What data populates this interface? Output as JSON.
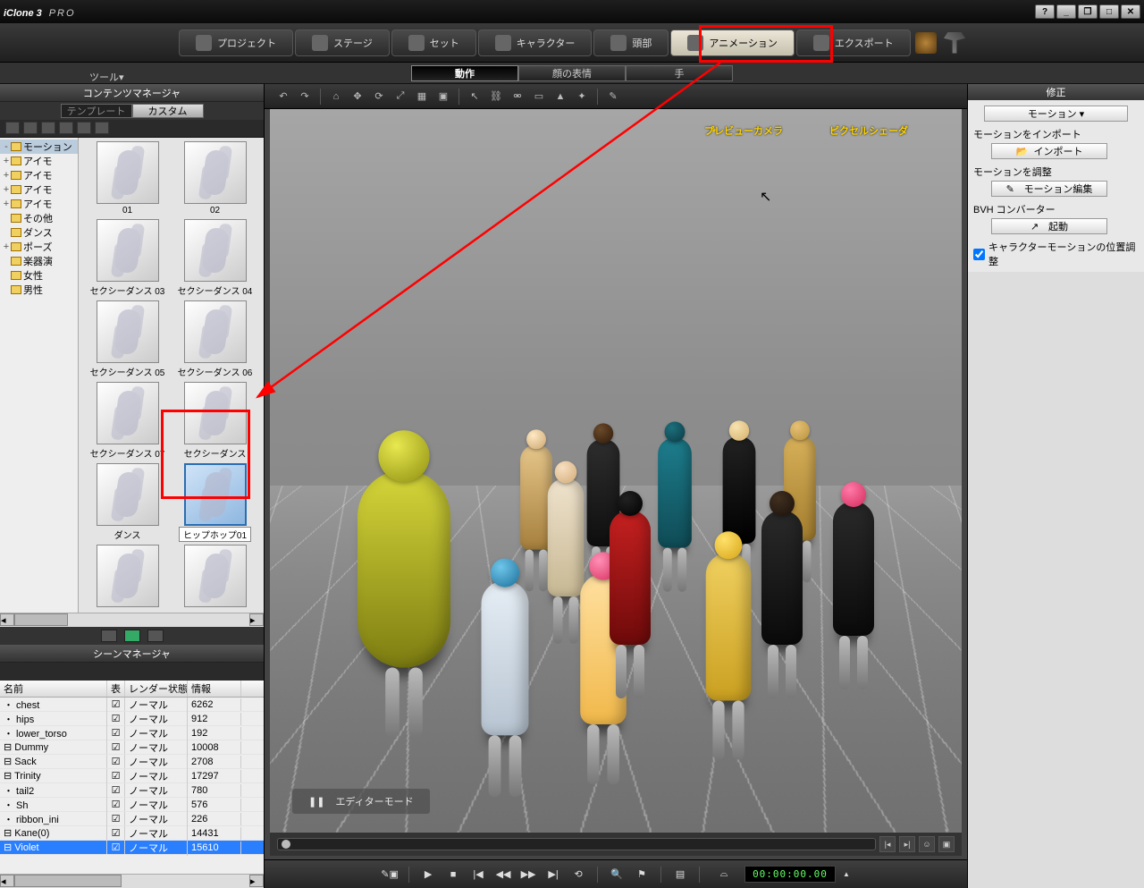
{
  "app": {
    "title": "iClone 3",
    "edition": "PRO"
  },
  "window_buttons": {
    "help": "?",
    "min": "_",
    "restore": "❐",
    "max": "□",
    "close": "✕"
  },
  "main_tabs": [
    {
      "label": "プロジェクト"
    },
    {
      "label": "ステージ"
    },
    {
      "label": "セット"
    },
    {
      "label": "キャラクター"
    },
    {
      "label": "頭部"
    },
    {
      "label": "アニメーション",
      "active": true
    },
    {
      "label": "エクスポート"
    }
  ],
  "sub_tabs": [
    {
      "label": "動作",
      "active": true
    },
    {
      "label": "顔の表情"
    },
    {
      "label": "手"
    }
  ],
  "tool_menu": "ツール▾",
  "content_manager": {
    "title": "コンテンツマネージャ",
    "tabs": [
      {
        "label": "テンプレート"
      },
      {
        "label": "カスタム",
        "active": true
      }
    ],
    "tree": [
      {
        "exp": "-",
        "label": "モーション",
        "sel": true
      },
      {
        "exp": "+",
        "label": "アイモ"
      },
      {
        "exp": "+",
        "label": "アイモ"
      },
      {
        "exp": "+",
        "label": "アイモ"
      },
      {
        "exp": "+",
        "label": "アイモ"
      },
      {
        "exp": "",
        "label": "その他"
      },
      {
        "exp": "",
        "label": "ダンス"
      },
      {
        "exp": "+",
        "label": "ポーズ"
      },
      {
        "exp": "",
        "label": "楽器演"
      },
      {
        "exp": "",
        "label": "女性"
      },
      {
        "exp": "",
        "label": "男性"
      }
    ],
    "thumbs": [
      {
        "lbl": "01"
      },
      {
        "lbl": "02"
      },
      {
        "lbl": "セクシーダンス 03"
      },
      {
        "lbl": "セクシーダンス 04"
      },
      {
        "lbl": "セクシーダンス 05"
      },
      {
        "lbl": "セクシーダンス 06"
      },
      {
        "lbl": "セクシーダンス 07"
      },
      {
        "lbl": "セクシーダンス"
      },
      {
        "lbl": "ダンス"
      },
      {
        "lbl": "ヒップホップ01",
        "selected": true
      },
      {
        "lbl": ""
      },
      {
        "lbl": ""
      }
    ]
  },
  "scene_manager": {
    "title": "シーンマネージャ",
    "headers": {
      "name": "名前",
      "chk": "表",
      "render": "レンダー状態",
      "info": "情報"
    },
    "rows": [
      {
        "name": "・ chest",
        "render": "ノーマル",
        "info": "6262"
      },
      {
        "name": "・ hips",
        "render": "ノーマル",
        "info": "912"
      },
      {
        "name": "・ lower_torso",
        "render": "ノーマル",
        "info": "192"
      },
      {
        "name": "⊟ Dummy",
        "render": "ノーマル",
        "info": "10008"
      },
      {
        "name": "⊟ Sack",
        "render": "ノーマル",
        "info": "2708"
      },
      {
        "name": "⊟ Trinity",
        "render": "ノーマル",
        "info": "17297"
      },
      {
        "name": "・ tail2",
        "render": "ノーマル",
        "info": "780"
      },
      {
        "name": "・ Sh",
        "render": "ノーマル",
        "info": "576"
      },
      {
        "name": "・ ribbon_ini",
        "render": "ノーマル",
        "info": "226"
      },
      {
        "name": "⊟ Kane(0)",
        "render": "ノーマル",
        "info": "14431"
      },
      {
        "name": "⊟ Violet",
        "render": "ノーマル",
        "info": "15610",
        "sel": true
      }
    ]
  },
  "viewport": {
    "label_preview_camera": "プレビューカメラ",
    "label_pixel_shader": "ピクセルシェーダ",
    "editor_mode": "エディターモード",
    "pause_glyph": "❚❚"
  },
  "timecode": "00:00:00.00",
  "right_panel": {
    "title": "修正",
    "motion_label": "モーション",
    "sec_import": "モーションをインポート",
    "btn_import": "インポート",
    "sec_adjust": "モーションを調整",
    "btn_edit": "モーション編集",
    "sec_bvh": "BVH コンバーター",
    "btn_launch": "起動",
    "chk_pos_adjust": "キャラクターモーションの位置調整"
  }
}
